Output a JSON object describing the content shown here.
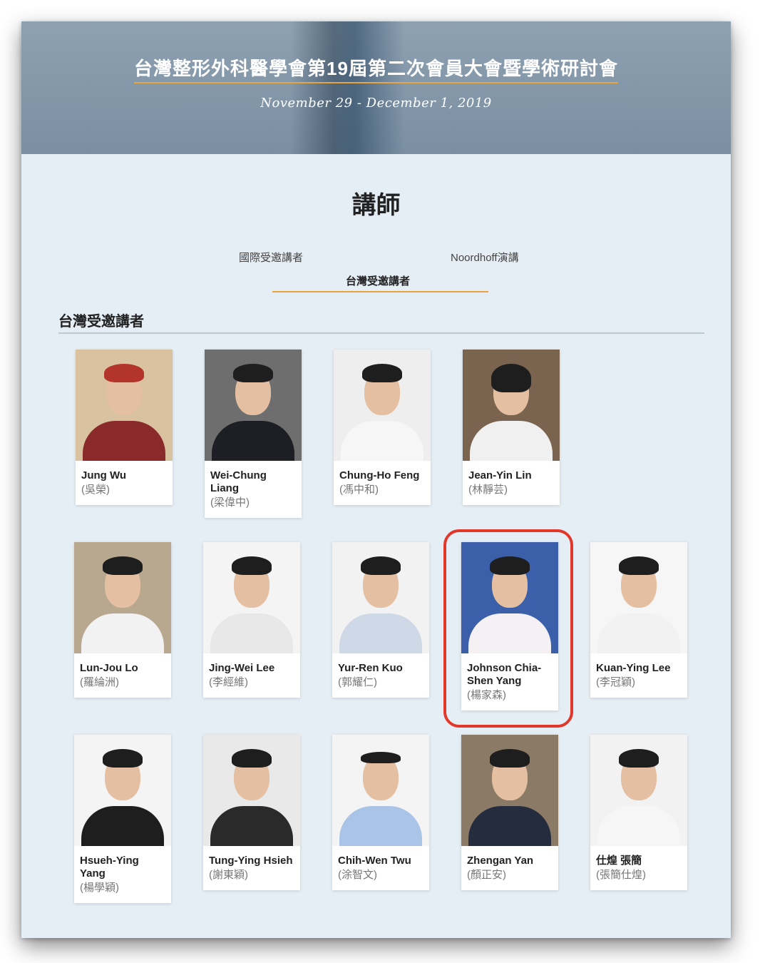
{
  "banner": {
    "title": "台灣整形外科醫學會第19屆第二次會員大會暨學術研討會",
    "date": "November 29 - December 1, 2019"
  },
  "page_title": "講師",
  "tabs": [
    {
      "label": "國際受邀講者",
      "active": false
    },
    {
      "label": "Noordhoff演講",
      "active": false
    },
    {
      "label": "台灣受邀講者",
      "active": true
    }
  ],
  "section_heading": "台灣受邀講者",
  "speakers": [
    {
      "name": "Jung Wu",
      "chinese": "(吳榮)",
      "bg": "#d9c2a0",
      "shirt": "#8a2a2a"
    },
    {
      "name": "Wei-Chung Liang",
      "chinese": "(梁偉中)",
      "bg": "#6e6e6e",
      "shirt": "#1d1f24"
    },
    {
      "name": "Chung-Ho Feng",
      "chinese": "(馮中和)",
      "bg": "#eeeeee",
      "shirt": "#f6f6f6"
    },
    {
      "name": "Jean-Yin Lin",
      "chinese": "(林靜芸)",
      "bg": "#7a6450",
      "shirt": "#f0f0f0"
    },
    {
      "name": "Lun-Jou Lo",
      "chinese": "(羅綸洲)",
      "bg": "#b8a88f",
      "shirt": "#f2f2f2"
    },
    {
      "name": "Jing-Wei Lee",
      "chinese": "(李經維)",
      "bg": "#f4f4f4",
      "shirt": "#e8e8e8"
    },
    {
      "name": "Yur-Ren Kuo",
      "chinese": "(郭耀仁)",
      "bg": "#f2f2f2",
      "shirt": "#cfd8e6"
    },
    {
      "name": "Johnson Chia-Shen Yang",
      "chinese": "(楊家森)",
      "bg": "#3b5fa8",
      "shirt": "#f4f0f4"
    },
    {
      "name": "Kuan-Ying Lee",
      "chinese": "(李冠穎)",
      "bg": "#f6f6f6",
      "shirt": "#f2f2f2"
    },
    {
      "name": "Hsueh-Ying Yang",
      "chinese": "(楊學穎)",
      "bg": "#f4f4f4",
      "shirt": "#1e1e1e"
    },
    {
      "name": "Tung-Ying Hsieh",
      "chinese": "(謝東穎)",
      "bg": "#e9e9e9",
      "shirt": "#2a2a2a"
    },
    {
      "name": "Chih-Wen Twu",
      "chinese": "(涂智文)",
      "bg": "#f4f4f4",
      "shirt": "#a9c4e6"
    },
    {
      "name": "Zhengan Yan",
      "chinese": "(顏正安)",
      "bg": "#8a7a66",
      "shirt": "#242c3e"
    },
    {
      "name": "仕煌 張簡",
      "chinese": "(張簡仕煌)",
      "bg": "#f2f2f2",
      "shirt": "#f6f6f6"
    }
  ]
}
